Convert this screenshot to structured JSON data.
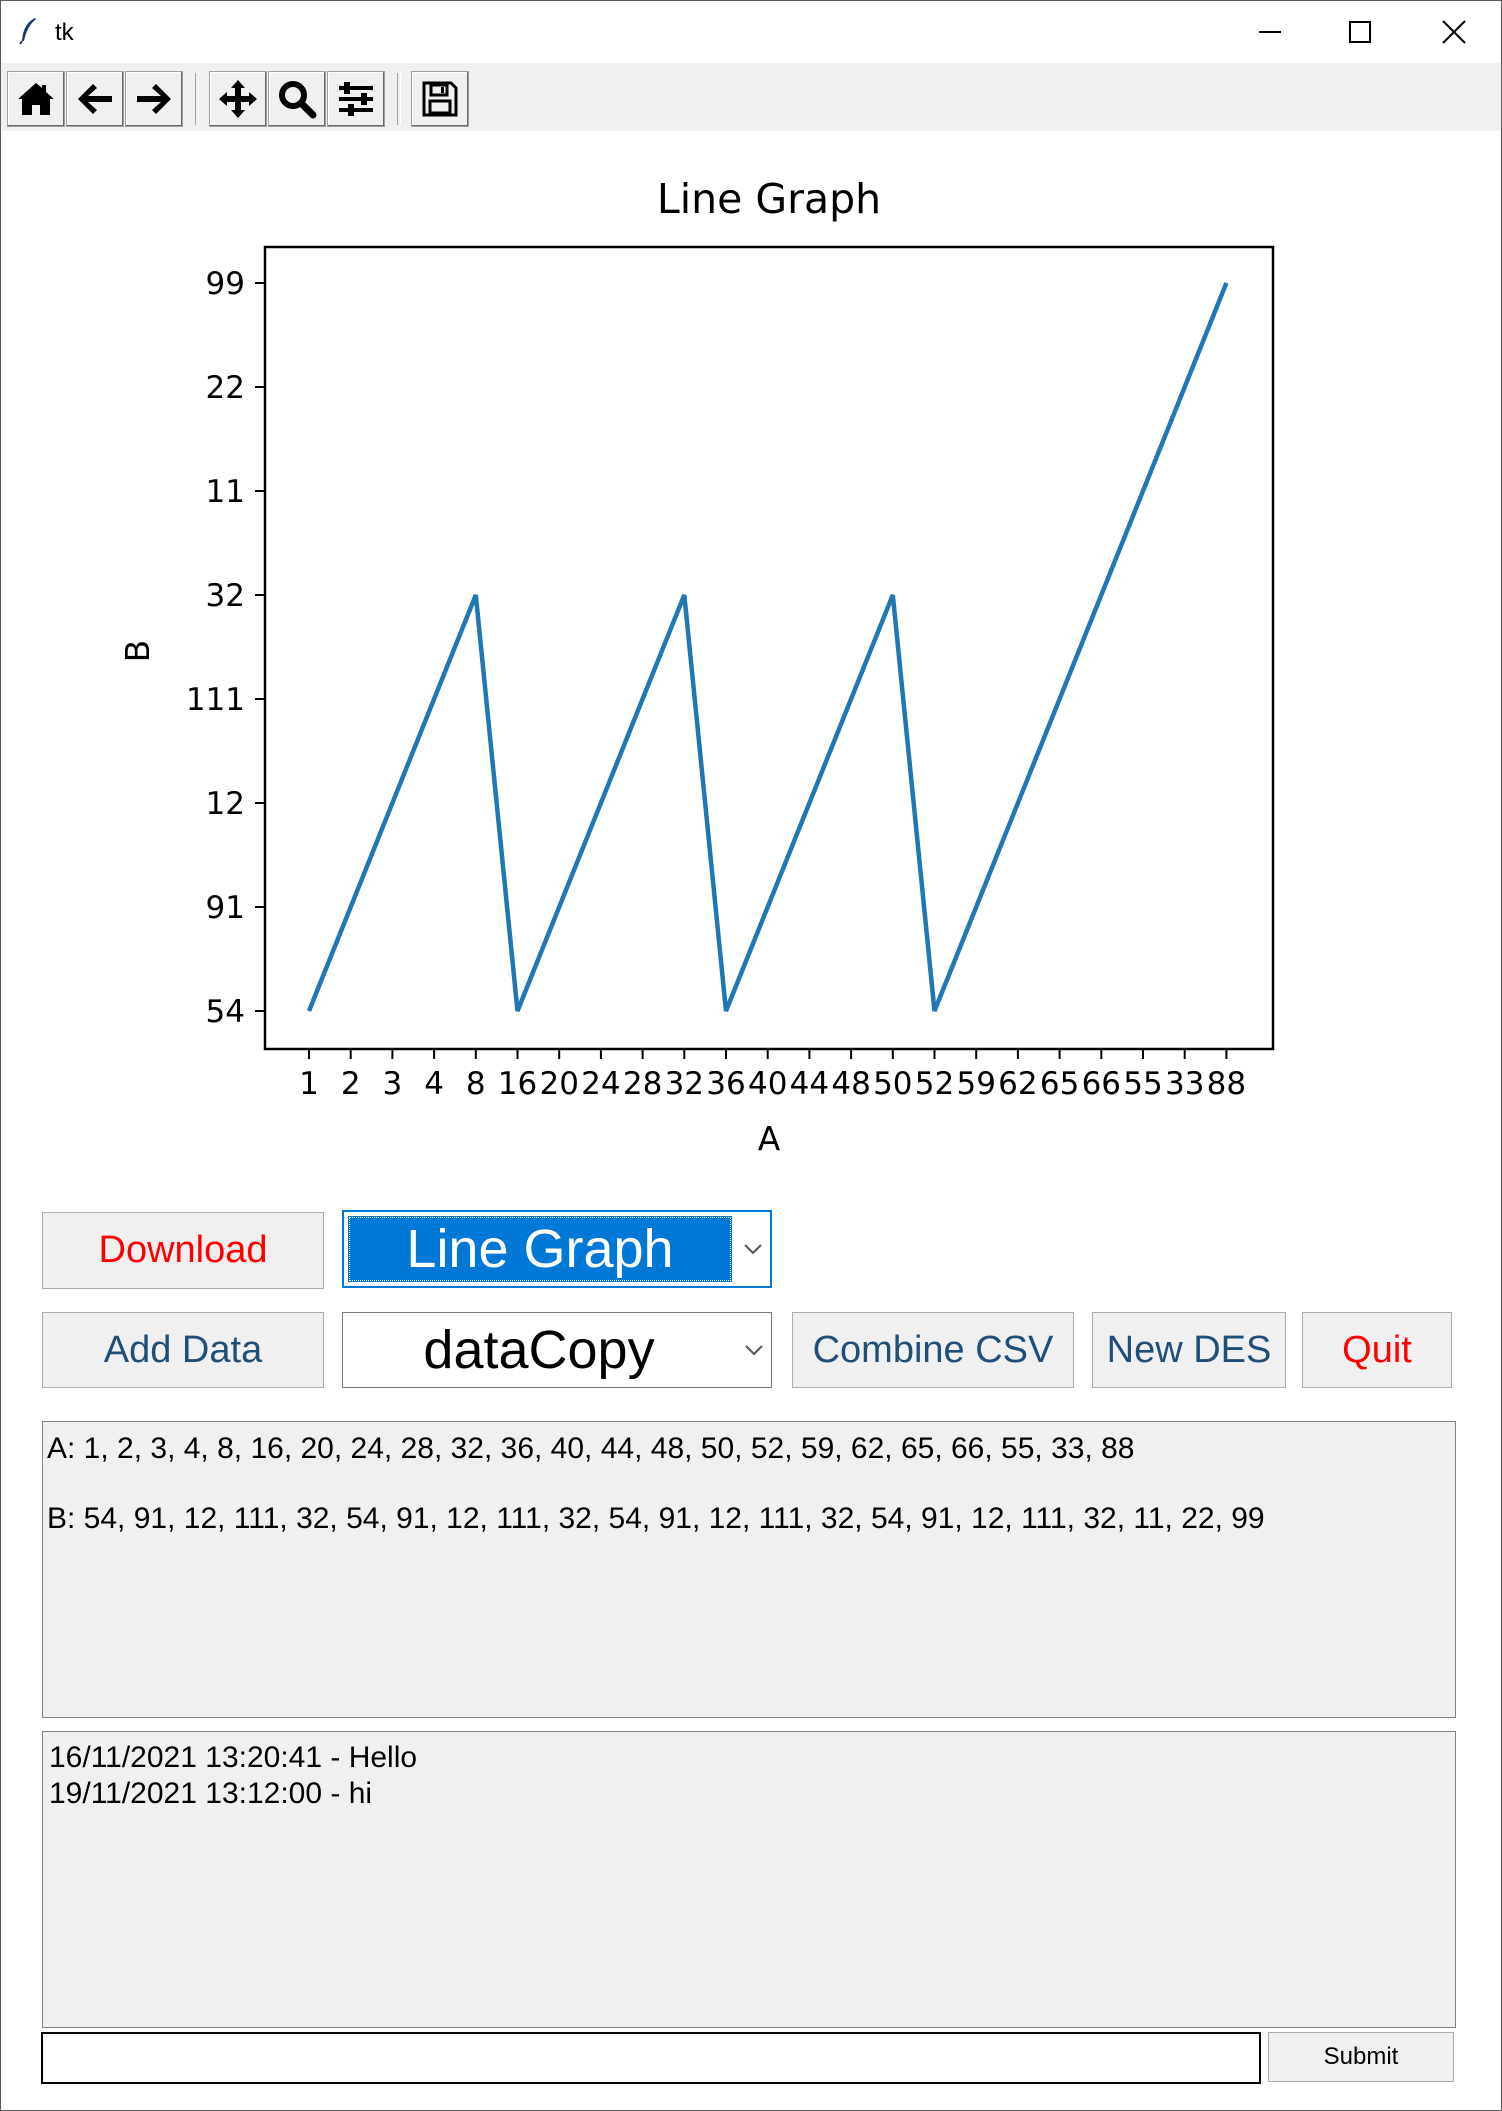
{
  "window": {
    "title": "tk"
  },
  "toolbar": {
    "buttons": [
      {
        "name": "home-icon"
      },
      {
        "name": "back-arrow-icon"
      },
      {
        "name": "forward-arrow-icon"
      },
      {
        "name": "pan-icon"
      },
      {
        "name": "zoom-icon"
      },
      {
        "name": "configure-subplots-icon"
      },
      {
        "name": "save-icon"
      }
    ]
  },
  "chart_data": {
    "type": "line",
    "title": "Line Graph",
    "xlabel": "A",
    "ylabel": "B",
    "x": [
      "1",
      "2",
      "3",
      "4",
      "8",
      "16",
      "20",
      "24",
      "28",
      "32",
      "36",
      "40",
      "44",
      "48",
      "50",
      "52",
      "59",
      "62",
      "65",
      "66",
      "55",
      "33",
      "88"
    ],
    "y_categories": [
      "54",
      "91",
      "12",
      "111",
      "32",
      "11",
      "22",
      "99"
    ],
    "points": [
      {
        "x": "1",
        "y": "54"
      },
      {
        "x": "8",
        "y": "32"
      },
      {
        "x": "16",
        "y": "54"
      },
      {
        "x": "32",
        "y": "32"
      },
      {
        "x": "36",
        "y": "54"
      },
      {
        "x": "50",
        "y": "32"
      },
      {
        "x": "52",
        "y": "54"
      },
      {
        "x": "88",
        "y": "99"
      }
    ],
    "series_color": "#1f77b4",
    "grid": false
  },
  "controls": {
    "download_label": "Download",
    "graph_type_value": "Line Graph",
    "add_data_label": "Add Data",
    "dataset_value": "dataCopy",
    "combine_label": "Combine CSV",
    "new_des_label": "New DES",
    "quit_label": "Quit"
  },
  "data_panel": {
    "line_a": "A: 1, 2, 3, 4, 8, 16, 20, 24, 28, 32, 36, 40, 44, 48, 50, 52, 59, 62, 65, 66, 55, 33, 88",
    "line_b": "B: 54, 91, 12, 111, 32, 54, 91, 12, 111, 32, 54, 91, 12, 111, 32, 54, 91, 12, 111, 32, 11, 22, 99"
  },
  "log_panel": {
    "entries": [
      "16/11/2021 13:20:41 - Hello",
      "19/11/2021 13:12:00 - hi"
    ]
  },
  "input": {
    "value": "",
    "submit_label": "Submit"
  },
  "colors": {
    "accent": "#0078d7",
    "red_text": "#ff0000",
    "blue_text": "#1f4e79"
  }
}
